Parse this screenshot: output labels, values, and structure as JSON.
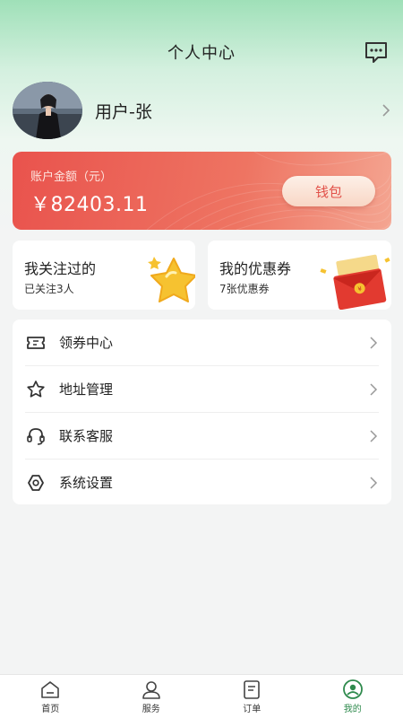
{
  "header": {
    "title": "个人中心",
    "message_icon": "chat-dots-icon"
  },
  "profile": {
    "username": "用户-张"
  },
  "balance": {
    "label": "账户金额（元）",
    "amount": "￥82403.11",
    "wallet_label": "钱包",
    "card_color": "#e9534d"
  },
  "tiles": [
    {
      "title": "我关注过的",
      "subtitle": "已关注3人",
      "icon": "star-icon"
    },
    {
      "title": "我的优惠券",
      "subtitle": "7张优惠券",
      "icon": "coupon-envelope-icon"
    }
  ],
  "menu": [
    {
      "label": "领券中心",
      "icon": "ticket-icon"
    },
    {
      "label": "地址管理",
      "icon": "star-outline-icon"
    },
    {
      "label": "联系客服",
      "icon": "headset-icon"
    },
    {
      "label": "系统设置",
      "icon": "settings-hexagon-icon"
    }
  ],
  "tabbar": [
    {
      "label": "首页",
      "icon": "home-icon"
    },
    {
      "label": "服务",
      "icon": "user-service-icon"
    },
    {
      "label": "订单",
      "icon": "order-list-icon"
    },
    {
      "label": "我的",
      "icon": "profile-icon",
      "active": true
    }
  ],
  "colors": {
    "accent": "#2f8a4d",
    "header_green": "#9fe0b8",
    "wallet_text": "#e2524a"
  }
}
